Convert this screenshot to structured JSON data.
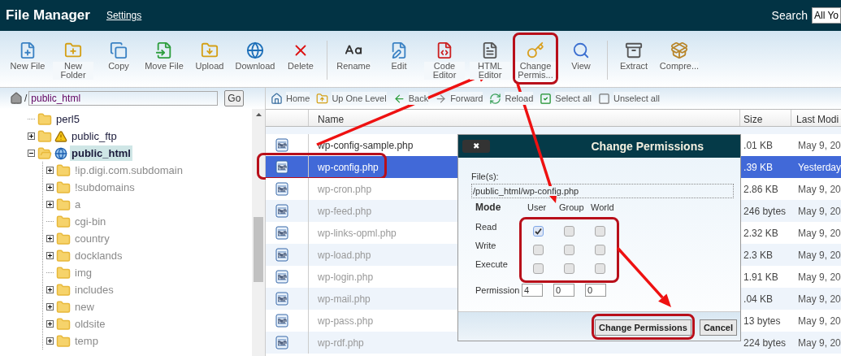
{
  "header": {
    "title": "File Manager",
    "settings_link": "Settings",
    "search_label": "Search",
    "search_scope": "All Yo"
  },
  "toolbar": [
    {
      "items": [
        {
          "label": "New File",
          "highlighted": false
        },
        {
          "label": "New Folder",
          "highlighted": false
        },
        {
          "label": "Copy",
          "highlighted": false
        },
        {
          "label": "Move File",
          "highlighted": false
        },
        {
          "label": "Upload",
          "highlighted": false
        },
        {
          "label": "Download",
          "highlighted": false
        },
        {
          "label": "Delete",
          "highlighted": false
        }
      ]
    },
    {
      "items": [
        {
          "label": "Rename",
          "highlighted": false
        },
        {
          "label": "Edit",
          "highlighted": false
        },
        {
          "label": "Code Editor",
          "highlighted": false
        },
        {
          "label": "HTML Editor",
          "highlighted": false
        },
        {
          "label": "Change Permis...",
          "highlighted": true
        },
        {
          "label": "View",
          "highlighted": false
        }
      ]
    },
    {
      "items": [
        {
          "label": "Extract",
          "highlighted": false
        },
        {
          "label": "Compre...",
          "highlighted": false
        }
      ]
    }
  ],
  "path_bar": {
    "separator": "/",
    "value": "public_html",
    "go": "Go"
  },
  "tree": [
    {
      "label": "perl5",
      "kind": "folder",
      "expandable": false,
      "expanded": false,
      "selected": false
    },
    {
      "label": "public_ftp",
      "kind": "ftp",
      "expandable": true,
      "expanded": false,
      "selected": false
    },
    {
      "label": "public_html",
      "kind": "web",
      "expandable": true,
      "expanded": true,
      "selected": true,
      "children": [
        {
          "label": "!ip.digi.com.subdomain",
          "kind": "folder",
          "expandable": true,
          "expanded": false,
          "selected": false,
          "blurred": true
        },
        {
          "label": "!subdomains",
          "kind": "folder",
          "expandable": true,
          "expanded": false,
          "selected": false,
          "blurred": true
        },
        {
          "label": "a",
          "kind": "folder",
          "expandable": true,
          "expanded": false,
          "selected": false,
          "blurred": true
        },
        {
          "label": "cgi-bin",
          "kind": "folder",
          "expandable": false,
          "expanded": false,
          "selected": false,
          "blurred": true
        },
        {
          "label": "country",
          "kind": "folder",
          "expandable": true,
          "expanded": false,
          "selected": false,
          "blurred": true
        },
        {
          "label": "docklands",
          "kind": "folder",
          "expandable": true,
          "expanded": false,
          "selected": false,
          "blurred": true
        },
        {
          "label": "img",
          "kind": "folder",
          "expandable": false,
          "expanded": false,
          "selected": false,
          "blurred": true
        },
        {
          "label": "includes",
          "kind": "folder",
          "expandable": true,
          "expanded": false,
          "selected": false,
          "blurred": true
        },
        {
          "label": "new",
          "kind": "folder",
          "expandable": true,
          "expanded": false,
          "selected": false,
          "blurred": true
        },
        {
          "label": "oldsite",
          "kind": "folder",
          "expandable": true,
          "expanded": false,
          "selected": false,
          "blurred": true
        },
        {
          "label": "temp",
          "kind": "folder",
          "expandable": true,
          "expanded": false,
          "selected": false,
          "blurred": true
        }
      ]
    }
  ],
  "nav_bar": [
    "Home",
    "Up One Level",
    "Back",
    "Forward",
    "Reload",
    "Select all",
    "Unselect all"
  ],
  "table": {
    "columns": [
      "Name",
      "Size",
      "Last Modi"
    ],
    "rows": [
      {
        "name": "wp-config-sample.php",
        "size": ".01 KB",
        "modified": "May 9, 20",
        "selected": false,
        "blurred": false,
        "highlighted": false
      },
      {
        "name": "wp-config.php",
        "size": ".39 KB",
        "modified": "Yesterday",
        "selected": true,
        "blurred": false,
        "highlighted": true
      },
      {
        "name": "wp-cron.php",
        "size": "2.86 KB",
        "modified": "May 9, 20",
        "selected": false,
        "blurred": true,
        "highlighted": false
      },
      {
        "name": "wp-feed.php",
        "size": "246 bytes",
        "modified": "May 9, 20",
        "selected": false,
        "blurred": true,
        "highlighted": false
      },
      {
        "name": "wp-links-opml.php",
        "size": "2.32 KB",
        "modified": "May 9, 20",
        "selected": false,
        "blurred": true,
        "highlighted": false
      },
      {
        "name": "wp-load.php",
        "size": "2.3 KB",
        "modified": "May 9, 20",
        "selected": false,
        "blurred": true,
        "highlighted": false
      },
      {
        "name": "wp-login.php",
        "size": "1.91 KB",
        "modified": "May 9, 20",
        "selected": false,
        "blurred": true,
        "highlighted": false
      },
      {
        "name": "wp-mail.php",
        "size": ".04 KB",
        "modified": "May 9, 20",
        "selected": false,
        "blurred": true,
        "highlighted": false
      },
      {
        "name": "wp-pass.php",
        "size": "13 bytes",
        "modified": "May 9, 20",
        "selected": false,
        "blurred": true,
        "highlighted": false
      },
      {
        "name": "wp-rdf.php",
        "size": "224 bytes",
        "modified": "May 9, 20",
        "selected": false,
        "blurred": true,
        "highlighted": false
      }
    ]
  },
  "dialog": {
    "close": "✖",
    "title": "Change Permissions",
    "files_label": "File(s):",
    "file_path": "/public_html/wp-config.php",
    "mode_label": "Mode",
    "columns": [
      "User",
      "Group",
      "World"
    ],
    "grid_highlighted": true,
    "modes": [
      {
        "label": "Read",
        "checked": [
          true,
          false,
          false
        ]
      },
      {
        "label": "Write",
        "checked": [
          false,
          false,
          false
        ]
      },
      {
        "label": "Execute",
        "checked": [
          false,
          false,
          false
        ]
      }
    ],
    "permission_label": "Permission",
    "permission_values": [
      "4",
      "0",
      "0"
    ],
    "buttons": [
      {
        "label": "Change Permissions",
        "highlighted": true
      },
      {
        "label": "Cancel",
        "highlighted": false
      }
    ]
  }
}
